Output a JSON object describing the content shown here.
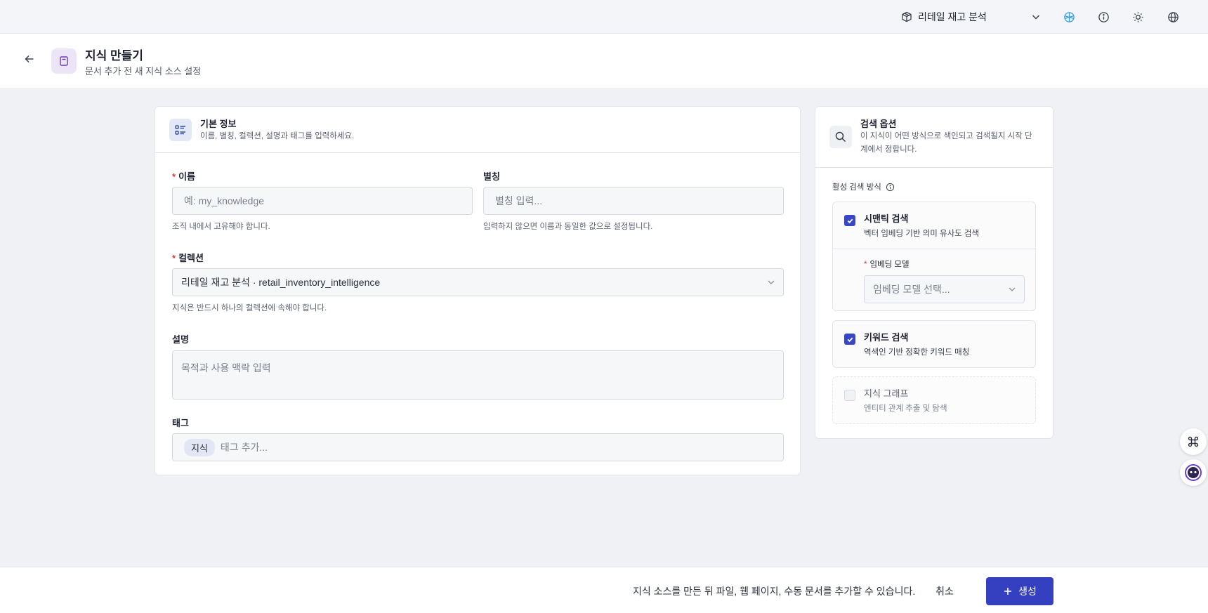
{
  "topbar": {
    "workspace_name": "리테일 재고 분석",
    "icons": [
      "workspace-cube-icon",
      "chevron-down-icon",
      "globe-link-icon",
      "info-icon",
      "theme-sun-icon",
      "language-globe-icon"
    ]
  },
  "header": {
    "title": "지식 만들기",
    "subtitle": "문서 추가 전 새 지식 소스 설정"
  },
  "basic_info": {
    "title": "기본 정보",
    "description": "이름, 별칭, 컬렉션, 설명과 태그를 입력하세요.",
    "name": {
      "label": "이름",
      "required_mark": "*",
      "placeholder": "예: my_knowledge",
      "hint": "조직 내에서 고유해야 합니다."
    },
    "alias": {
      "label": "별칭",
      "placeholder": "별칭 입력...",
      "hint": "입력하지 않으면 이름과 동일한 값으로 설정됩니다."
    },
    "collection": {
      "label": "컬렉션",
      "required_mark": "*",
      "value": "리테일 재고 분석 · retail_inventory_intelligence",
      "hint": "지식은 반드시 하나의 컬렉션에 속해야 합니다."
    },
    "description_field": {
      "label": "설명",
      "placeholder": "목적과 사용 맥락 입력"
    },
    "tags": {
      "label": "태그",
      "chips": [
        "지식"
      ],
      "placeholder": "태그 추가..."
    }
  },
  "search_options": {
    "title": "검색 옵션",
    "description": "이 지식이 어떤 방식으로 색인되고 검색될지 시작 단계에서 정합니다.",
    "active_methods_label": "활성 검색 방식",
    "semantic": {
      "title": "시맨틱 검색",
      "description": "벡터 임베딩 기반 의미 유사도 검색",
      "checked": true,
      "embedding_label": "임베딩 모델",
      "required_mark": "*",
      "embedding_placeholder": "임베딩 모델 선택..."
    },
    "keyword": {
      "title": "키워드 검색",
      "description": "역색인 기반 정확한 키워드 매칭",
      "checked": true
    },
    "graph": {
      "title": "지식 그래프",
      "description": "엔티티 관계 추출 및 탐색",
      "checked": false
    }
  },
  "footer": {
    "note": "지식 소스를 만든 뒤 파일, 웹 페이지, 수동 문서를 추가할 수 있습니다.",
    "cancel_label": "취소",
    "create_label": "생성"
  },
  "colors": {
    "primary": "#3440c0",
    "checkbox": "#3848c4",
    "required": "#d23b3b",
    "badge_bg": "#ece4f7"
  }
}
